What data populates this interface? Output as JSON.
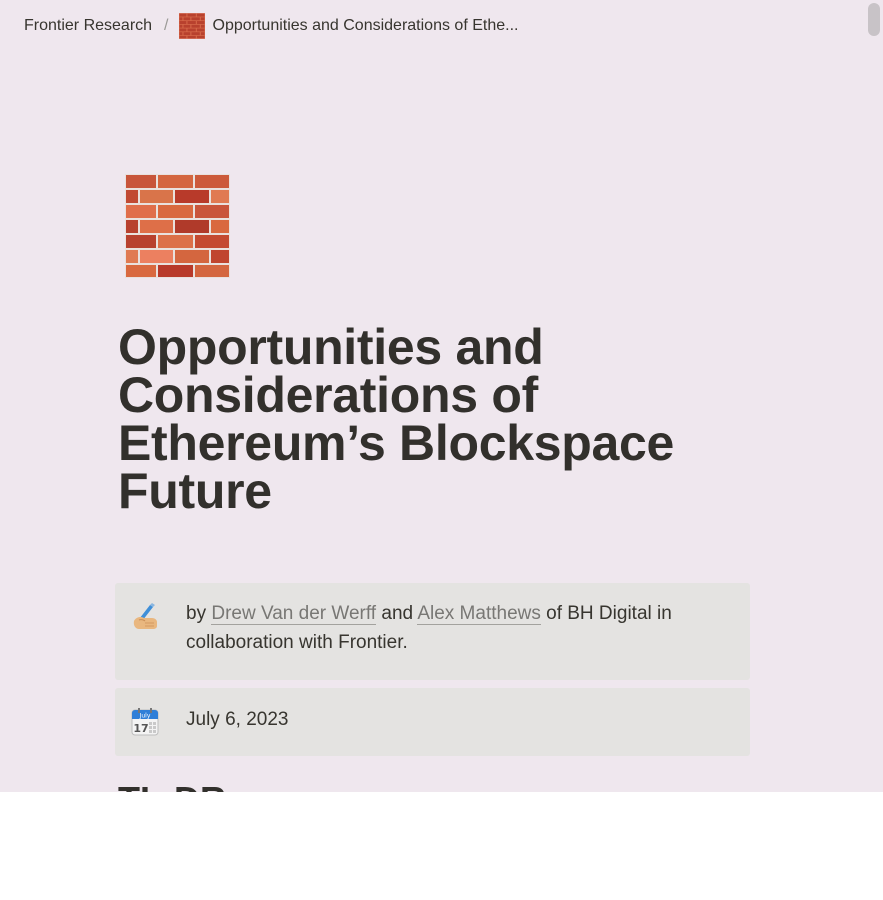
{
  "breadcrumb": {
    "parent": "Frontier Research",
    "separator": "/",
    "current": "Opportunities and Considerations of Ethe..."
  },
  "page": {
    "icon": "brick-icon",
    "title_lines": [
      "Opportunities and",
      "Considerations of",
      "Ethereum’s Blockspace",
      "Future"
    ]
  },
  "author_callout": {
    "icon": "writing-hand-icon",
    "prefix": "by ",
    "author1": "Drew Van der Werff",
    "conjunction": " and ",
    "author2": "Alex Matthews",
    "suffix": " of BH Digital in collaboration with Frontier."
  },
  "date_callout": {
    "icon": "calendar-icon",
    "calendar_month": "July",
    "calendar_day": "17",
    "date": "July 6, 2023"
  },
  "next_heading": "TL;DR"
}
